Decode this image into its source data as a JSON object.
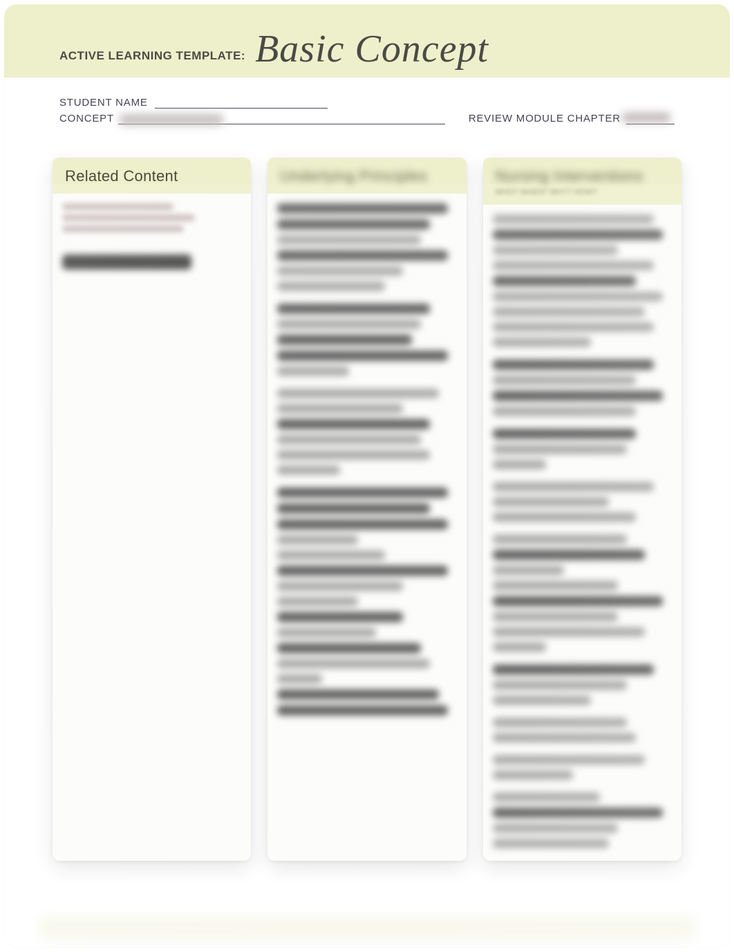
{
  "banner": {
    "label": "ACTIVE LEARNING TEMPLATE:",
    "title": "Basic Concept"
  },
  "meta": {
    "student_label": "STUDENT NAME",
    "concept_label": "CONCEPT",
    "review_label": "REVIEW MODULE CHAPTER"
  },
  "cards": {
    "left": {
      "title": "Related Content",
      "subtitle": ""
    },
    "middle": {
      "title_blurred": "Underlying Principles"
    },
    "right": {
      "title_blurred": "Nursing Interventions",
      "subtitle_blurred": "WHO? WHEN? WHY? HOW?"
    }
  }
}
